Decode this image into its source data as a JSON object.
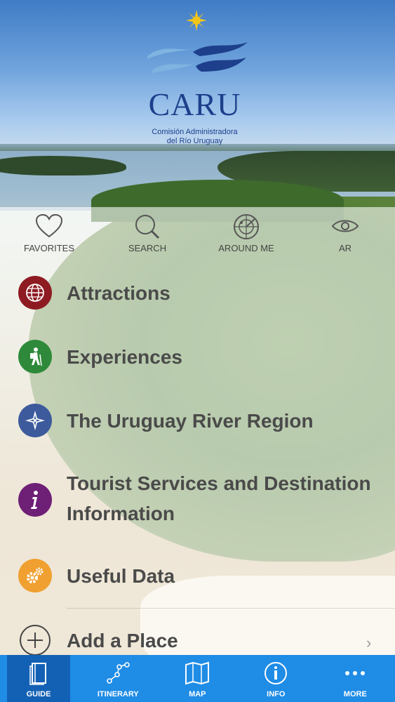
{
  "header": {
    "logo_name": "CARU",
    "logo_subtitle_line1": "Comisión Administradora",
    "logo_subtitle_line2": "del Río Uruguay"
  },
  "quick_actions": [
    {
      "label": "FAVORITES",
      "icon": "heart-icon"
    },
    {
      "label": "SEARCH",
      "icon": "search-icon"
    },
    {
      "label": "AROUND ME",
      "icon": "radar-icon"
    },
    {
      "label": "AR",
      "icon": "eye-icon"
    }
  ],
  "menu": [
    {
      "label": "Attractions",
      "icon": "globe-icon",
      "color": "#8e1b22"
    },
    {
      "label": "Experiences",
      "icon": "hiker-icon",
      "color": "#2e8a3a"
    },
    {
      "label": "The Uruguay River Region",
      "icon": "compass-icon",
      "color": "#3c5a9c"
    },
    {
      "label_line1": "Tourist Services and Destination",
      "label_line2": "Information",
      "icon": "info-icon",
      "color": "#6e1f76"
    },
    {
      "label": "Useful Data",
      "icon": "gears-icon",
      "color": "#f0a030"
    },
    {
      "label": "Add a Place",
      "icon": "plus-circle-icon"
    }
  ],
  "tabs": [
    {
      "label": "GUIDE",
      "icon": "book-icon",
      "active": true
    },
    {
      "label": "ITINERARY",
      "icon": "route-icon"
    },
    {
      "label": "MAP",
      "icon": "map-icon"
    },
    {
      "label": "INFO",
      "icon": "info-circle-icon"
    },
    {
      "label": "MORE",
      "icon": "more-icon"
    }
  ],
  "colors": {
    "tabbar": "#1f8ce6",
    "tab_active": "#1361b5",
    "logo": "#1d3f8c"
  }
}
